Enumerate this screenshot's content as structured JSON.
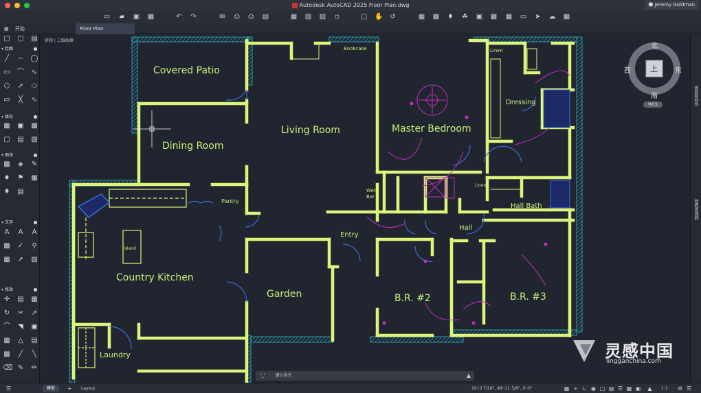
{
  "window": {
    "title": "Autodesk AutoCAD 2025   Floor Plan.dwg",
    "user": "Jeremy Goldman",
    "traffic_colors": [
      "#ff5f57",
      "#febc2e",
      "#28c840"
    ]
  },
  "tabs": {
    "start_label": "开始",
    "drawing_label": "Floor Plan"
  },
  "view": {
    "label": "- [ 俯视 ] [ 二维线框 ]",
    "label_short": "俯视 | 二维线框"
  },
  "palette": {
    "sections": [
      {
        "label": "绘图"
      },
      {
        "label": "填充"
      },
      {
        "label": "图块"
      },
      {
        "label": "文字"
      },
      {
        "label": "修改"
      }
    ]
  },
  "right_strip": {
    "label_1": "图层和特性",
    "label_2": "参照管理器"
  },
  "viewcube": {
    "north": "北",
    "south": "南",
    "east": "东",
    "west": "西",
    "top": "上",
    "wcs": "WCS"
  },
  "rooms": {
    "covered_patio": "Covered Patio",
    "dining_room": "Dining Room",
    "living_room": "Living Room",
    "master_bedroom": "Master Bedroom",
    "bookcase": "Bookcase",
    "linen_top": "Linen",
    "dressing": "Dressing",
    "pantry": "Pantry",
    "wet_bar_1": "Wet",
    "wet_bar_2": "Bar",
    "linen_mid": "Linen",
    "hall_bath": "Hall Bath",
    "island": "Island",
    "country_kitchen": "Country Kitchen",
    "entry": "Entry",
    "hall": "Hall",
    "garden": "Garden",
    "br2": "B.R. #2",
    "br3": "B.R. #3",
    "laundry": "Laundry"
  },
  "command": {
    "prompt": "\"_\"",
    "placeholder": "键入命令"
  },
  "status": {
    "model_tab": "模型",
    "layout_tab": "Layout",
    "coordinates": "10'-3 7/16\",  49'-11 5/8\",  0'-0\"",
    "scale": "1:1"
  },
  "watermark": {
    "brand": "灵感中国",
    "url": "lingganchina.com"
  },
  "colors": {
    "wall": "#dcf57a",
    "cyan": "#2fb5c8",
    "magenta": "#c02fc0",
    "door_blue": "#3a6fd8",
    "label": "#c8f07a"
  }
}
